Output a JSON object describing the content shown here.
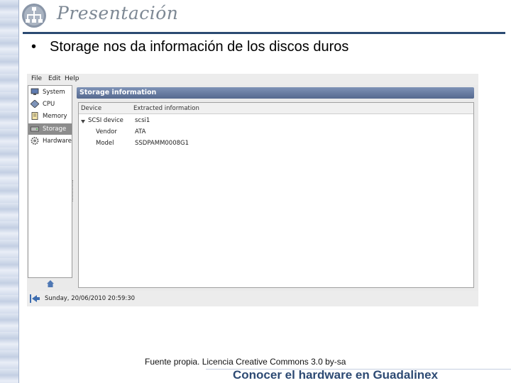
{
  "slide": {
    "title": "Presentación",
    "bullet_symbol": "•",
    "bullet_text": "Storage nos da información de los discos duros",
    "caption": "Fuente propia. Licencia Creative Commons 3.0 by-sa",
    "footer": "Conocer el hardware en Guadalinex"
  },
  "app": {
    "menu": [
      {
        "label": "File"
      },
      {
        "label": "Edit"
      },
      {
        "label": "Help"
      }
    ],
    "sidebar": [
      {
        "label": "System",
        "icon": "monitor-icon"
      },
      {
        "label": "CPU",
        "icon": "cpu-icon"
      },
      {
        "label": "Memory",
        "icon": "memory-icon"
      },
      {
        "label": "Storage",
        "icon": "storage-icon",
        "selected": true
      },
      {
        "label": "Hardware",
        "icon": "gear-icon"
      }
    ],
    "panel_title": "Storage information",
    "table": {
      "headers": [
        "Device",
        "Extracted information"
      ],
      "rows": [
        {
          "device": "SCSI device",
          "info": "scsi1"
        },
        {
          "device": "Vendor",
          "info": "ATA"
        },
        {
          "device": "Model",
          "info": "SSDPAMM0008G1"
        }
      ]
    },
    "status_text": "Sunday, 20/06/2010 20:59:30"
  }
}
